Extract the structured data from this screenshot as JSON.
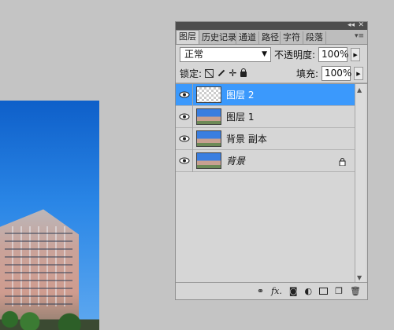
{
  "panel": {
    "titlebar": {
      "collapse": "◂◂",
      "close": "✕"
    },
    "tabs": [
      {
        "label": "图层",
        "active": true
      },
      {
        "label": "历史记录",
        "active": false
      },
      {
        "label": "通道",
        "active": false
      },
      {
        "label": "路径",
        "active": false
      },
      {
        "label": "字符",
        "active": false
      },
      {
        "label": "段落",
        "active": false
      }
    ],
    "menu_icon": "panel-menu-icon",
    "blend_mode": "正常",
    "opacity_label": "不透明度:",
    "opacity_value": "100%",
    "lock_label": "锁定:",
    "fill_label": "填充:",
    "fill_value": "100%",
    "layers": [
      {
        "name": "图层 2",
        "selected": true,
        "thumb": "transparent",
        "italic": false,
        "locked": false
      },
      {
        "name": "图层 1",
        "selected": false,
        "thumb": "photo",
        "italic": false,
        "locked": false
      },
      {
        "name": "背景 副本",
        "selected": false,
        "thumb": "photo",
        "italic": false,
        "locked": false
      },
      {
        "name": "背景",
        "selected": false,
        "thumb": "photo",
        "italic": true,
        "locked": true
      }
    ],
    "bottom_icons": [
      "link-icon",
      "fx-icon",
      "mask-icon",
      "adjustment-icon",
      "group-icon",
      "new-layer-icon",
      "trash-icon"
    ],
    "fx_text": "fx."
  },
  "colors": {
    "selection": "#3b99fc",
    "panel_bg": "#d6d6d6",
    "workspace_bg": "#c4c4c4"
  }
}
